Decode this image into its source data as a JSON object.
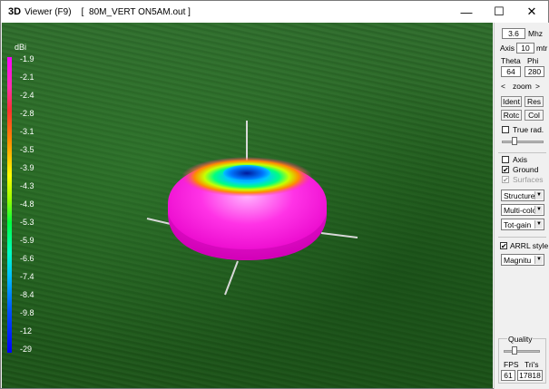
{
  "window": {
    "logo": "3D",
    "title": "Viewer (F9)    [  80M_VERT ON5AM.out ]",
    "controls": [
      "—",
      "☐",
      "✕"
    ]
  },
  "scale": {
    "unit": "dBi",
    "values": [
      "-1.9",
      "-2.1",
      "-2.4",
      "-2.8",
      "-3.1",
      "-3.5",
      "-3.9",
      "-4.3",
      "-4.8",
      "-5.3",
      "-5.9",
      "-6.6",
      "-7.4",
      "-8.4",
      "-9.8",
      "-12",
      "-29"
    ]
  },
  "panel": {
    "freq_value": "3.6",
    "freq_unit": "Mhz",
    "axis_label": "Axis",
    "axis_value": "10",
    "axis_unit": "mtr",
    "theta_label": "Theta",
    "phi_label": "Phi",
    "theta_value": "64",
    "phi_value": "280",
    "zoom_left": "<",
    "zoom_label": "zoom",
    "zoom_right": ">",
    "ident_label": "Ident",
    "res_label": "Res",
    "rotc_label": "Rotc",
    "col_label": "Col",
    "true_rad_label": "True rad.",
    "true_rad_checked": false,
    "axis_check_label": "Axis",
    "axis_checked": false,
    "ground_label": "Ground",
    "ground_checked": true,
    "surfaces_label": "Surfaces",
    "surfaces_checked": true,
    "structure_select": "Structure",
    "multicolor_select": "Multi-colo",
    "totgain_select": "Tot-gain",
    "arrl_label": "ARRL style",
    "arrl_checked": true,
    "magnitude_select": "Magnitu",
    "quality_label": "Quality",
    "fps_label": "FPS",
    "tris_label": "Tri's",
    "fps_value": "61",
    "tris_value": "17818"
  }
}
